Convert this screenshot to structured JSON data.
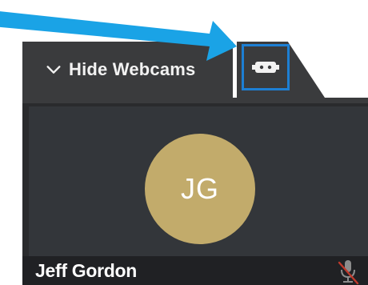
{
  "toolbar": {
    "hide_webcams_label": "Hide Webcams"
  },
  "participant": {
    "initials": "JG",
    "name": "Jeff Gordon",
    "avatar_color": "#c2ab6b"
  },
  "colors": {
    "highlight": "#1d7fd4",
    "arrow": "#1aa3e6",
    "tab_bg": "#3a3b3d",
    "panel_bg": "#2a2b2d"
  },
  "icons": {
    "chevron": "chevron-down-icon",
    "toggle": "webcam-toggle-icon",
    "mic": "microphone-muted-icon"
  }
}
